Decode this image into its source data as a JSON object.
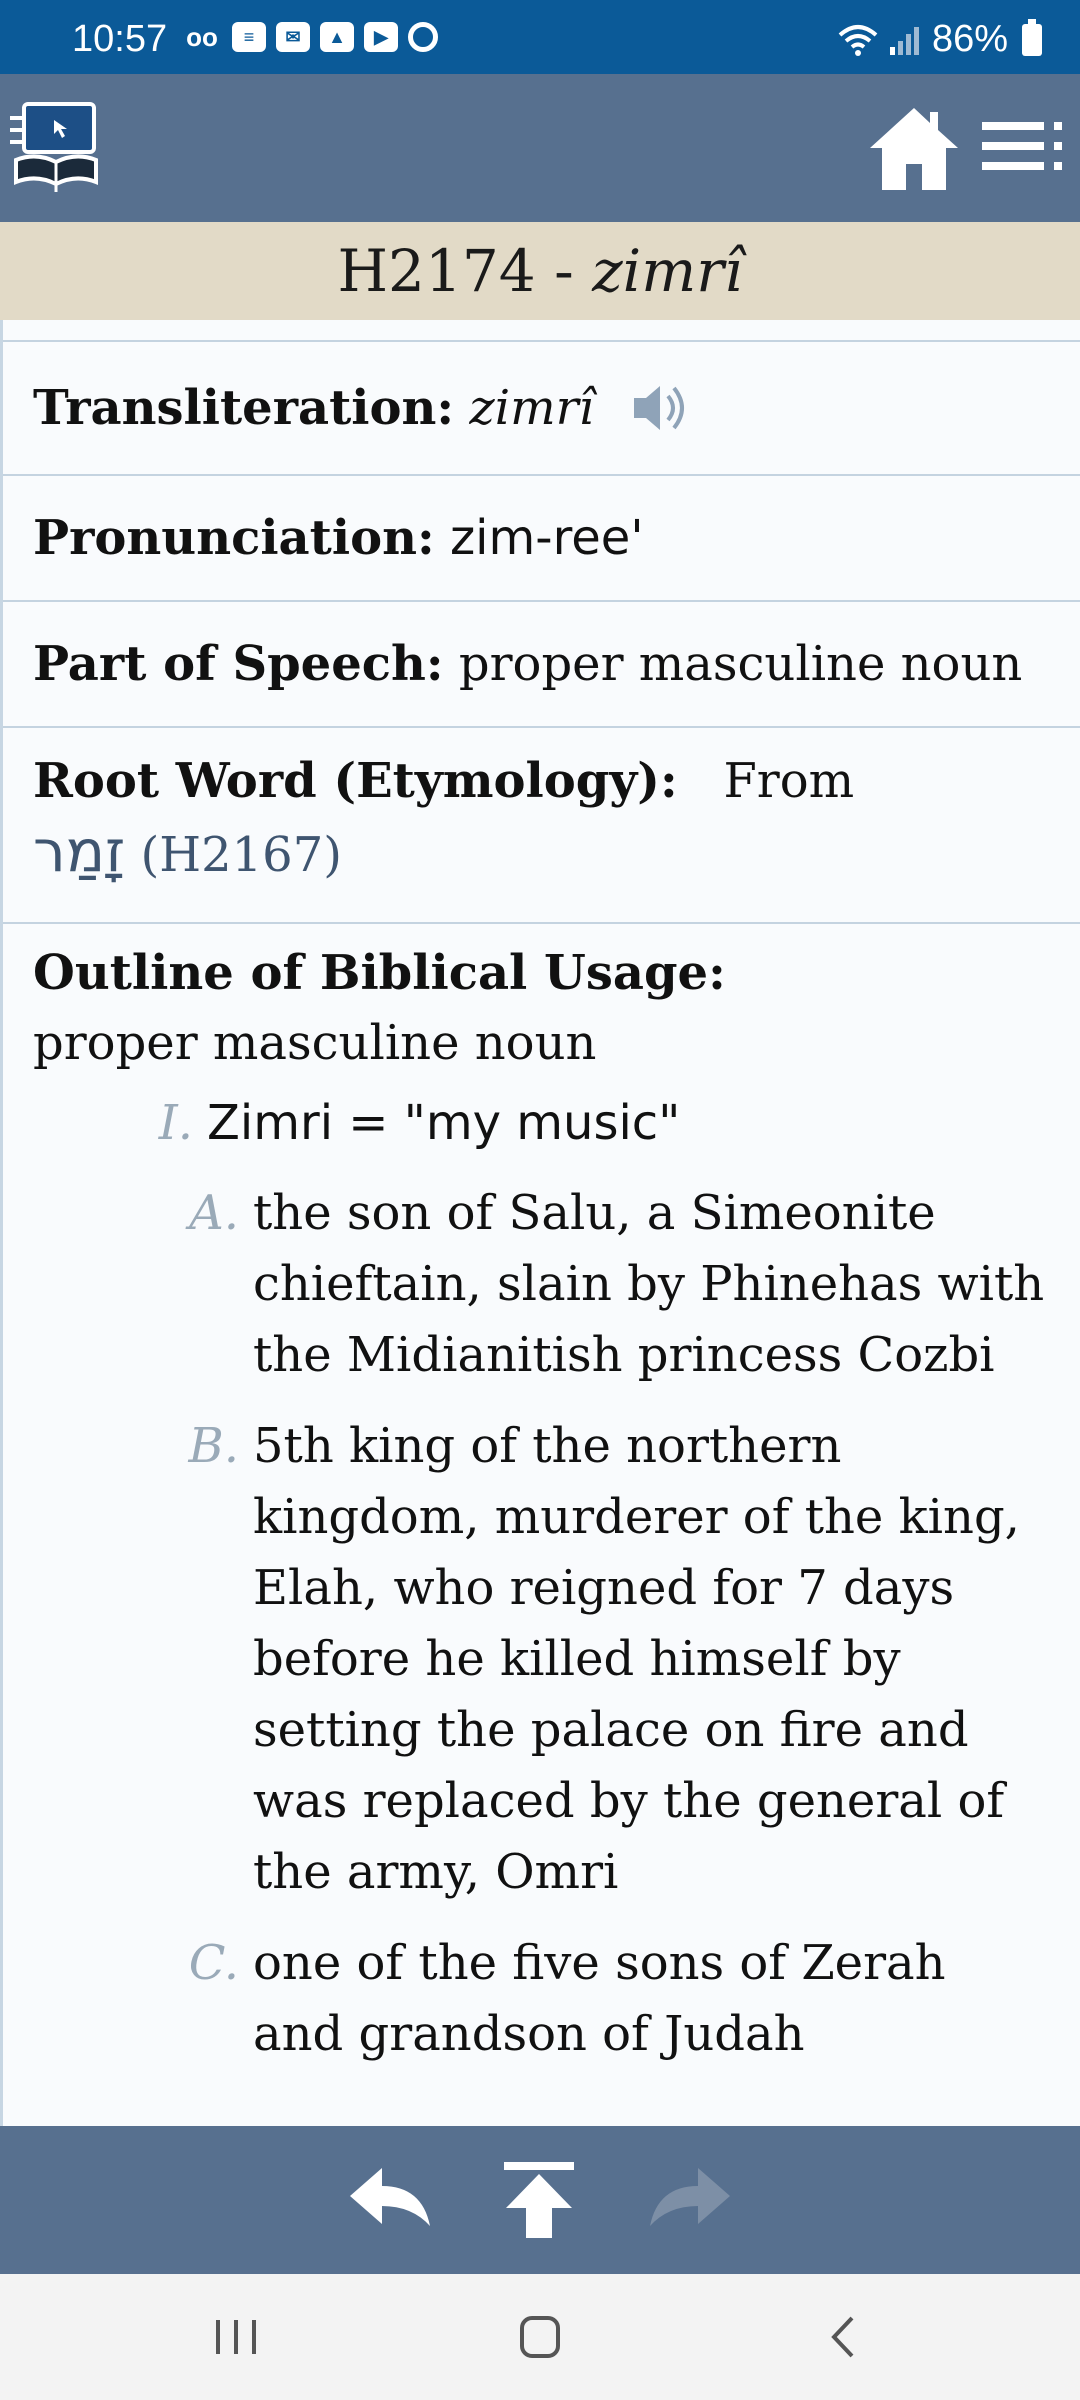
{
  "status_bar": {
    "time": "10:57",
    "battery": "86%",
    "notification_icons": [
      "voicemail-icon",
      "list-icon",
      "mail-icon",
      "gallery-icon",
      "youtube-icon",
      "sync-icon"
    ]
  },
  "header": {
    "logo": "bible-logo-icon",
    "home_icon": "home-icon",
    "menu_icon": "menu-icon"
  },
  "title": {
    "code": "H2174 - ",
    "word": "zimrî"
  },
  "entry": {
    "transliteration": {
      "label": "Transliteration:",
      "value": "zimrî"
    },
    "pronunciation": {
      "label": "Pronunciation:",
      "value": "zim-ree'"
    },
    "part_of_speech": {
      "label": "Part of Speech:",
      "value": "proper masculine noun"
    },
    "root_word": {
      "label": "Root Word (Etymology):",
      "prefix": "From",
      "hebrew": "זָמַר",
      "ref": "(H2167)"
    },
    "outline": {
      "label": "Outline of Biblical Usage:",
      "subtitle": "proper masculine noun",
      "items": [
        {
          "marker": "I.",
          "text": "Zimri = \"my music\"",
          "subitems": [
            {
              "marker": "A.",
              "text": "the son of Salu, a Simeonite chieftain, slain by Phinehas with the Midianitish princess Cozbi"
            },
            {
              "marker": "B.",
              "text": "5th king of the northern kingdom, murderer of the king, Elah, who reigned for 7 days before he killed himself by setting the palace on fire and was replaced by the general of the army, Omri"
            },
            {
              "marker": "C.",
              "text": "one of the five sons of Zerah and grandson of Judah"
            }
          ]
        }
      ]
    }
  },
  "bottom_nav": {
    "back_icon": "reply-back-icon",
    "top_icon": "scroll-to-top-icon",
    "forward_icon": "forward-icon"
  },
  "system_nav": {
    "recents_icon": "recents-icon",
    "home_icon": "system-home-icon",
    "back_icon": "system-back-icon"
  },
  "colors": {
    "status_bar": "#0b5a98",
    "header": "#57708f",
    "title_bar": "#e2dac7",
    "link": "#3f5570"
  }
}
